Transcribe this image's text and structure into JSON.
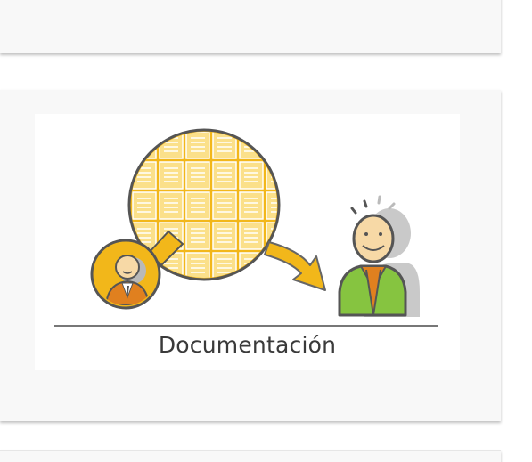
{
  "main_card": {
    "caption": "Documentación"
  },
  "colors": {
    "card_background": "#f8f8f8",
    "accent_yellow": "#f2b71a",
    "accent_orange": "#e0801f",
    "accent_green": "#86c440",
    "outline": "#555555"
  },
  "icons": {
    "documents": "document-grid-icon",
    "sender": "person-small-icon",
    "receiver": "person-happy-icon"
  }
}
